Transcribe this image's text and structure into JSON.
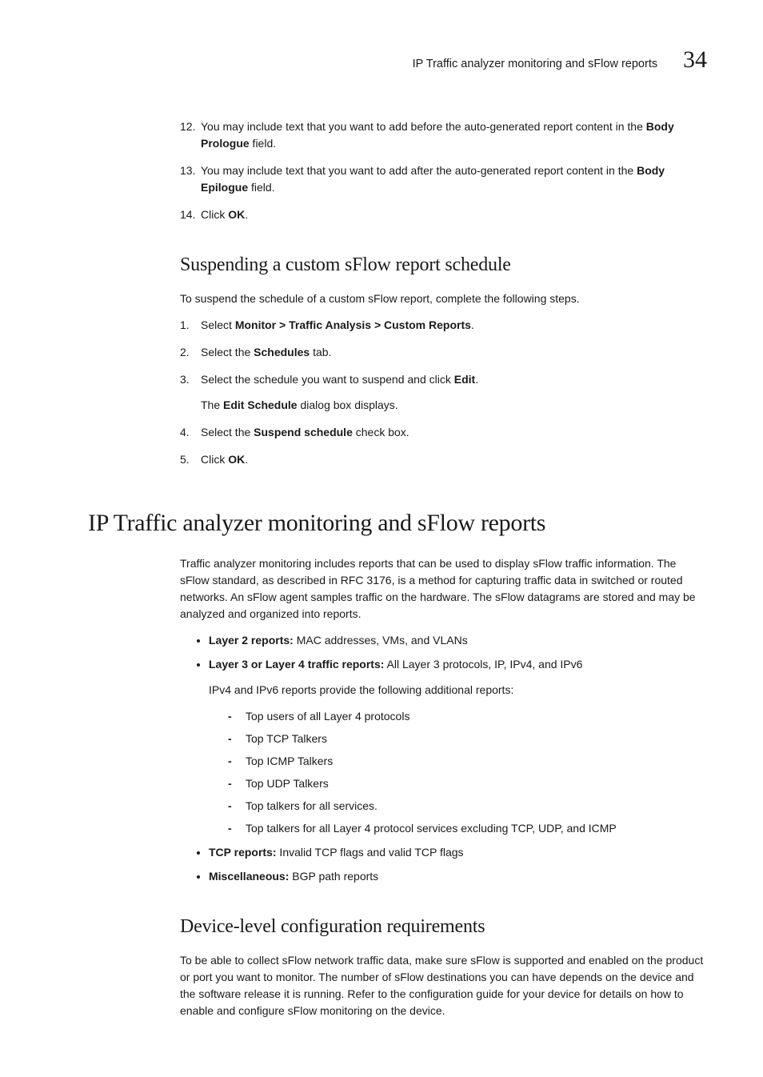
{
  "header": {
    "title": "IP Traffic analyzer monitoring and sFlow reports",
    "chapter": "34"
  },
  "top_steps": {
    "s12": {
      "num": "12.",
      "pre": "You may include text that you want to add before the auto-generated report content in the ",
      "bold": "Body Prologue",
      "post": " field."
    },
    "s13": {
      "num": "13.",
      "pre": "You may include text that you want to add after the auto-generated report content in the ",
      "bold": "Body Epilogue",
      "post": " field."
    },
    "s14": {
      "num": "14.",
      "pre": "Click ",
      "bold": "OK",
      "post": "."
    }
  },
  "suspend": {
    "heading": "Suspending a custom sFlow report schedule",
    "intro": "To suspend the schedule of a custom sFlow report, complete the following steps.",
    "steps": {
      "s1": {
        "num": "1.",
        "pre": "Select ",
        "bold": "Monitor > Traffic Analysis > Custom Reports",
        "post": "."
      },
      "s2": {
        "num": "2.",
        "pre": "Select the ",
        "bold": "Schedules",
        "post": " tab."
      },
      "s3": {
        "num": "3.",
        "pre": "Select the schedule you want to suspend and click ",
        "bold": "Edit",
        "post": ".",
        "sub_pre": "The ",
        "sub_bold": "Edit Schedule",
        "sub_post": " dialog box displays."
      },
      "s4": {
        "num": "4.",
        "pre": "Select the ",
        "bold": "Suspend schedule",
        "post": " check box."
      },
      "s5": {
        "num": "5.",
        "pre": "Click ",
        "bold": "OK",
        "post": "."
      }
    }
  },
  "ip_section": {
    "heading": "IP Traffic analyzer monitoring and sFlow reports",
    "intro": "Traffic analyzer monitoring includes reports that can be used to display sFlow traffic information. The sFlow standard, as described in RFC 3176, is a method for capturing traffic data in switched or routed networks. An sFlow agent samples traffic on the hardware. The sFlow datagrams are stored and may be analyzed and organized into reports.",
    "bullets": {
      "b1": {
        "bold": "Layer 2 reports:",
        "text": " MAC addresses, VMs, and VLANs"
      },
      "b2": {
        "bold": "Layer 3 or Layer 4 traffic reports:",
        "text": " All Layer 3 protocols, IP, IPv4, and IPv6",
        "sub_intro": "IPv4 and IPv6 reports provide the following additional reports:",
        "dashes": {
          "d1": "Top users of all Layer 4 protocols",
          "d2": "Top TCP Talkers",
          "d3": "Top ICMP Talkers",
          "d4": "Top UDP Talkers",
          "d5": "Top talkers for all services.",
          "d6": "Top talkers for all Layer 4 protocol services excluding TCP, UDP, and ICMP"
        }
      },
      "b3": {
        "bold": "TCP reports:",
        "text": " Invalid TCP flags and valid TCP flags"
      },
      "b4": {
        "bold": "Miscellaneous:",
        "text": " BGP path reports"
      }
    }
  },
  "device": {
    "heading": "Device-level configuration requirements",
    "body": "To be able to collect sFlow network traffic data, make sure sFlow is supported and enabled on the product or port you want to monitor. The number of sFlow destinations you can have depends on the device and the software release it is running. Refer to the configuration guide for your device for details on how to enable and configure sFlow monitoring on the device."
  }
}
